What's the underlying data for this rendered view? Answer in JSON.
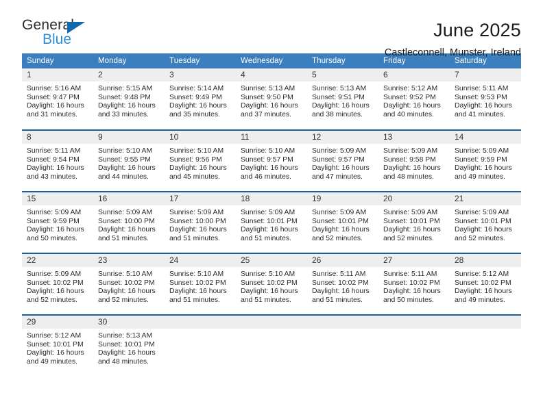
{
  "brand": {
    "name_part1": "General",
    "name_part2": "Blue",
    "triangle_icon": "blue-triangle-logo-mark",
    "color_dark": "#2b2b2b",
    "color_blue": "#2d8fd5",
    "color_triangle": "#1168ad"
  },
  "header": {
    "title": "June 2025",
    "subtitle": "Castleconnell, Munster, Ireland"
  },
  "colors": {
    "header_row_bg": "#3b7fbe",
    "header_row_text": "#ffffff",
    "week_separator": "#1a5f9e",
    "daynum_bg": "#eeeeee",
    "body_text": "#2a2a2a"
  },
  "weekday_headers": [
    "Sunday",
    "Monday",
    "Tuesday",
    "Wednesday",
    "Thursday",
    "Friday",
    "Saturday"
  ],
  "labels": {
    "sunrise_prefix": "Sunrise:",
    "sunset_prefix": "Sunset:",
    "daylight_prefix": "Daylight:"
  },
  "weeks": [
    [
      {
        "day": "1",
        "line1": "Sunrise: 5:16 AM",
        "line2": "Sunset: 9:47 PM",
        "line3": "Daylight: 16 hours",
        "line4": "and 31 minutes."
      },
      {
        "day": "2",
        "line1": "Sunrise: 5:15 AM",
        "line2": "Sunset: 9:48 PM",
        "line3": "Daylight: 16 hours",
        "line4": "and 33 minutes."
      },
      {
        "day": "3",
        "line1": "Sunrise: 5:14 AM",
        "line2": "Sunset: 9:49 PM",
        "line3": "Daylight: 16 hours",
        "line4": "and 35 minutes."
      },
      {
        "day": "4",
        "line1": "Sunrise: 5:13 AM",
        "line2": "Sunset: 9:50 PM",
        "line3": "Daylight: 16 hours",
        "line4": "and 37 minutes."
      },
      {
        "day": "5",
        "line1": "Sunrise: 5:13 AM",
        "line2": "Sunset: 9:51 PM",
        "line3": "Daylight: 16 hours",
        "line4": "and 38 minutes."
      },
      {
        "day": "6",
        "line1": "Sunrise: 5:12 AM",
        "line2": "Sunset: 9:52 PM",
        "line3": "Daylight: 16 hours",
        "line4": "and 40 minutes."
      },
      {
        "day": "7",
        "line1": "Sunrise: 5:11 AM",
        "line2": "Sunset: 9:53 PM",
        "line3": "Daylight: 16 hours",
        "line4": "and 41 minutes."
      }
    ],
    [
      {
        "day": "8",
        "line1": "Sunrise: 5:11 AM",
        "line2": "Sunset: 9:54 PM",
        "line3": "Daylight: 16 hours",
        "line4": "and 43 minutes."
      },
      {
        "day": "9",
        "line1": "Sunrise: 5:10 AM",
        "line2": "Sunset: 9:55 PM",
        "line3": "Daylight: 16 hours",
        "line4": "and 44 minutes."
      },
      {
        "day": "10",
        "line1": "Sunrise: 5:10 AM",
        "line2": "Sunset: 9:56 PM",
        "line3": "Daylight: 16 hours",
        "line4": "and 45 minutes."
      },
      {
        "day": "11",
        "line1": "Sunrise: 5:10 AM",
        "line2": "Sunset: 9:57 PM",
        "line3": "Daylight: 16 hours",
        "line4": "and 46 minutes."
      },
      {
        "day": "12",
        "line1": "Sunrise: 5:09 AM",
        "line2": "Sunset: 9:57 PM",
        "line3": "Daylight: 16 hours",
        "line4": "and 47 minutes."
      },
      {
        "day": "13",
        "line1": "Sunrise: 5:09 AM",
        "line2": "Sunset: 9:58 PM",
        "line3": "Daylight: 16 hours",
        "line4": "and 48 minutes."
      },
      {
        "day": "14",
        "line1": "Sunrise: 5:09 AM",
        "line2": "Sunset: 9:59 PM",
        "line3": "Daylight: 16 hours",
        "line4": "and 49 minutes."
      }
    ],
    [
      {
        "day": "15",
        "line1": "Sunrise: 5:09 AM",
        "line2": "Sunset: 9:59 PM",
        "line3": "Daylight: 16 hours",
        "line4": "and 50 minutes."
      },
      {
        "day": "16",
        "line1": "Sunrise: 5:09 AM",
        "line2": "Sunset: 10:00 PM",
        "line3": "Daylight: 16 hours",
        "line4": "and 51 minutes."
      },
      {
        "day": "17",
        "line1": "Sunrise: 5:09 AM",
        "line2": "Sunset: 10:00 PM",
        "line3": "Daylight: 16 hours",
        "line4": "and 51 minutes."
      },
      {
        "day": "18",
        "line1": "Sunrise: 5:09 AM",
        "line2": "Sunset: 10:01 PM",
        "line3": "Daylight: 16 hours",
        "line4": "and 51 minutes."
      },
      {
        "day": "19",
        "line1": "Sunrise: 5:09 AM",
        "line2": "Sunset: 10:01 PM",
        "line3": "Daylight: 16 hours",
        "line4": "and 52 minutes."
      },
      {
        "day": "20",
        "line1": "Sunrise: 5:09 AM",
        "line2": "Sunset: 10:01 PM",
        "line3": "Daylight: 16 hours",
        "line4": "and 52 minutes."
      },
      {
        "day": "21",
        "line1": "Sunrise: 5:09 AM",
        "line2": "Sunset: 10:01 PM",
        "line3": "Daylight: 16 hours",
        "line4": "and 52 minutes."
      }
    ],
    [
      {
        "day": "22",
        "line1": "Sunrise: 5:09 AM",
        "line2": "Sunset: 10:02 PM",
        "line3": "Daylight: 16 hours",
        "line4": "and 52 minutes."
      },
      {
        "day": "23",
        "line1": "Sunrise: 5:10 AM",
        "line2": "Sunset: 10:02 PM",
        "line3": "Daylight: 16 hours",
        "line4": "and 52 minutes."
      },
      {
        "day": "24",
        "line1": "Sunrise: 5:10 AM",
        "line2": "Sunset: 10:02 PM",
        "line3": "Daylight: 16 hours",
        "line4": "and 51 minutes."
      },
      {
        "day": "25",
        "line1": "Sunrise: 5:10 AM",
        "line2": "Sunset: 10:02 PM",
        "line3": "Daylight: 16 hours",
        "line4": "and 51 minutes."
      },
      {
        "day": "26",
        "line1": "Sunrise: 5:11 AM",
        "line2": "Sunset: 10:02 PM",
        "line3": "Daylight: 16 hours",
        "line4": "and 51 minutes."
      },
      {
        "day": "27",
        "line1": "Sunrise: 5:11 AM",
        "line2": "Sunset: 10:02 PM",
        "line3": "Daylight: 16 hours",
        "line4": "and 50 minutes."
      },
      {
        "day": "28",
        "line1": "Sunrise: 5:12 AM",
        "line2": "Sunset: 10:02 PM",
        "line3": "Daylight: 16 hours",
        "line4": "and 49 minutes."
      }
    ],
    [
      {
        "day": "29",
        "line1": "Sunrise: 5:12 AM",
        "line2": "Sunset: 10:01 PM",
        "line3": "Daylight: 16 hours",
        "line4": "and 49 minutes."
      },
      {
        "day": "30",
        "line1": "Sunrise: 5:13 AM",
        "line2": "Sunset: 10:01 PM",
        "line3": "Daylight: 16 hours",
        "line4": "and 48 minutes."
      },
      {
        "day": "",
        "line1": "",
        "line2": "",
        "line3": "",
        "line4": ""
      },
      {
        "day": "",
        "line1": "",
        "line2": "",
        "line3": "",
        "line4": ""
      },
      {
        "day": "",
        "line1": "",
        "line2": "",
        "line3": "",
        "line4": ""
      },
      {
        "day": "",
        "line1": "",
        "line2": "",
        "line3": "",
        "line4": ""
      },
      {
        "day": "",
        "line1": "",
        "line2": "",
        "line3": "",
        "line4": ""
      }
    ]
  ]
}
